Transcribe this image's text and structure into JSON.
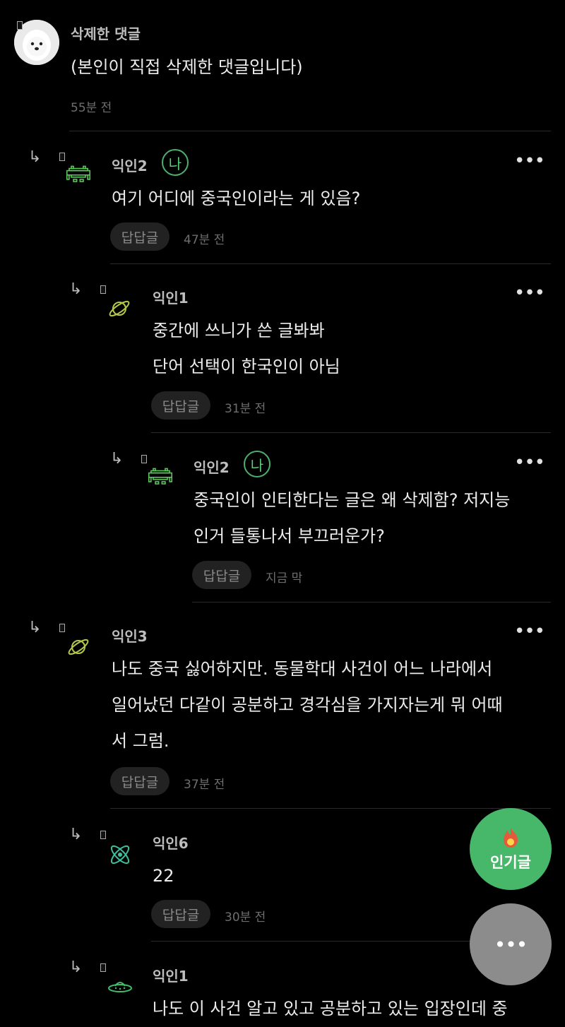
{
  "comments": [
    {
      "name": "삭제한 댓글",
      "text": "(본인이 직접 삭제한 댓글입니다)",
      "time": "55분 전"
    },
    {
      "name": "익인2",
      "badge": "나",
      "text": "여기 어디에 중국인이라는 게 있음?",
      "reply": "답답글",
      "time": "47분 전"
    },
    {
      "name": "익인1",
      "text": "중간에 쓰니가 쓴 글봐봐\n단어 선택이 한국인이 아님",
      "reply": "답답글",
      "time": "31분 전"
    },
    {
      "name": "익인2",
      "badge": "나",
      "text": "중국인이 인티한다는 글은 왜 삭제함? 저지능\n인거 들통나서 부끄러운가?",
      "reply": "답답글",
      "time": "지금 막"
    },
    {
      "name": "익인3",
      "text": "나도 중국 싫어하지만. 동물학대 사건이 어느 나라에서\n일어났던 다같이 공분하고 경각심을 가지자는게 뭐 어때\n서 그럼.",
      "reply": "답답글",
      "time": "37분 전"
    },
    {
      "name": "익인6",
      "text": "22",
      "reply": "답답글",
      "time": "30분 전"
    },
    {
      "name": "익인1",
      "text": "나도 이 사건 알고 있고 공분하고 있는 입장인데 중"
    }
  ],
  "ui": {
    "more_label": "•••",
    "reply_arrow": "↳",
    "popular_label": "인기글",
    "fab_more_label": "•••"
  },
  "colors": {
    "accent_green": "#4caf6d",
    "popular_fab": "#47b86a",
    "more_fab": "#8c8c8c"
  },
  "icons": {
    "deleted_avatar": "white-dog-avatar",
    "ikin2_avatar": "space-invader-icon",
    "ikin1_avatar": "planet-icon",
    "ikin3_avatar": "planet-icon",
    "ikin6_avatar": "atom-icon",
    "ikin1b_avatar": "ufo-icon"
  }
}
